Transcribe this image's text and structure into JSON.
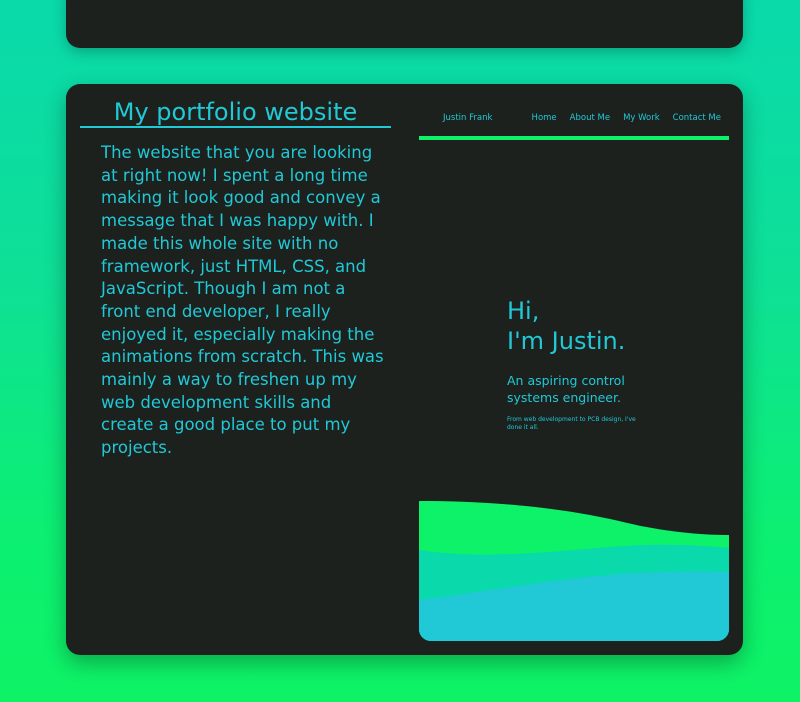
{
  "project": {
    "title": "My portfolio website",
    "description": "The website that you are looking at right now! I spent a long time making it look good and convey a message that I was happy with. I made this whole site with no framework, just HTML, CSS, and JavaScript. Though I am not a front end developer, I really enjoyed it, especially making the animations from scratch. This was mainly a way to freshen up my web development skills and create a good place to put my projects."
  },
  "preview": {
    "nav": {
      "brand": "Justin Frank",
      "links": [
        "Home",
        "About Me",
        "My Work",
        "Contact Me"
      ]
    },
    "hero": {
      "greeting_line1": "Hi,",
      "greeting_line2": "I'm Justin.",
      "subtitle": "An aspiring control systems engineer.",
      "tagline": "From web development to PCB design, I've done it all."
    }
  },
  "colors": {
    "accent": "#21c8d6",
    "green": "#0ef26a",
    "card": "#1c211e",
    "teal": "#0ad9ab"
  }
}
